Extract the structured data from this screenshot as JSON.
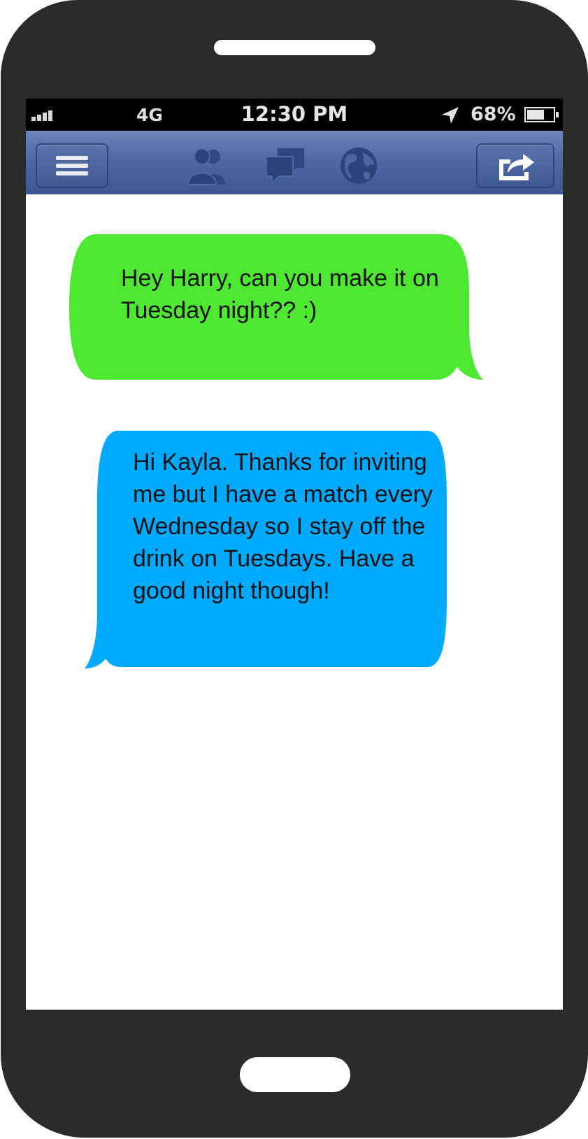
{
  "status_bar": {
    "network": "4G",
    "time": "12:30 PM",
    "battery": "68%",
    "battery_level": 0.68,
    "signal_bars": 4
  },
  "nav_bar": {
    "icons": [
      "menu-icon",
      "friends-icon",
      "messages-icon",
      "globe-icon",
      "share-icon"
    ]
  },
  "messages": [
    {
      "direction": "outgoing",
      "color": "#4ee832",
      "text": "Hey Harry, can you make it on Tuesday night?? :)"
    },
    {
      "direction": "incoming",
      "color": "#00aaff",
      "text": "Hi Kayla. Thanks for inviting me but I have a match every Wednesday so I stay off the drink on Tuesdays. Have a good night though!"
    }
  ],
  "colors": {
    "phone_body": "#2b2b2b",
    "nav_bar": "#4d68a4",
    "outgoing_bubble": "#4ee832",
    "incoming_bubble": "#00aaff"
  }
}
